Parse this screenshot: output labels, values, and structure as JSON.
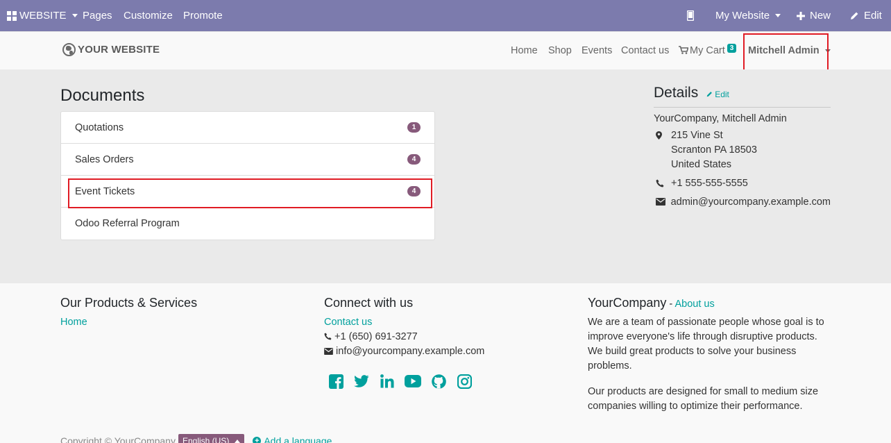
{
  "admin_bar": {
    "website_label": "WEBSITE",
    "pages": "Pages",
    "customize": "Customize",
    "promote": "Promote",
    "my_website": "My Website",
    "new": "New",
    "edit": "Edit"
  },
  "header": {
    "logo_text": "YOUR WEBSITE",
    "nav": [
      "Home",
      "Shop",
      "Events",
      "Contact us"
    ],
    "cart_label": "My Cart",
    "cart_count": "3",
    "user": "Mitchell Admin"
  },
  "documents": {
    "title": "Documents",
    "items": [
      {
        "label": "Quotations",
        "count": "1"
      },
      {
        "label": "Sales Orders",
        "count": "4"
      },
      {
        "label": "Event Tickets",
        "count": "4"
      },
      {
        "label": "Odoo Referral Program",
        "count": ""
      }
    ]
  },
  "details": {
    "title": "Details",
    "edit": "Edit",
    "company": "YourCompany, Mitchell Admin",
    "address": [
      "215 Vine St",
      "Scranton PA 18503",
      "United States"
    ],
    "phone": "+1 555-555-5555",
    "email": "admin@yourcompany.example.com"
  },
  "footer": {
    "col1_title": "Our Products & Services",
    "col1_link": "Home",
    "col2_title": "Connect with us",
    "col2_link": "Contact us",
    "col2_phone": "+1 (650) 691-3277",
    "col2_email": "info@yourcompany.example.com",
    "col3_title": "YourCompany",
    "col3_sep": " - ",
    "col3_link": "About us",
    "col3_p1": "We are a team of passionate people whose goal is to improve everyone's life through disruptive products. We build great products to solve your business problems.",
    "col3_p2": "Our products are designed for small to medium size companies willing to optimize their performance.",
    "copyright": "Copyright © YourCompany",
    "language": "English (US)",
    "add_language": "Add a language..."
  },
  "colors": {
    "admin_bar": "#7c7bad",
    "accent": "#00a09d",
    "badge": "#875a7b",
    "highlight": "#e01b24"
  }
}
